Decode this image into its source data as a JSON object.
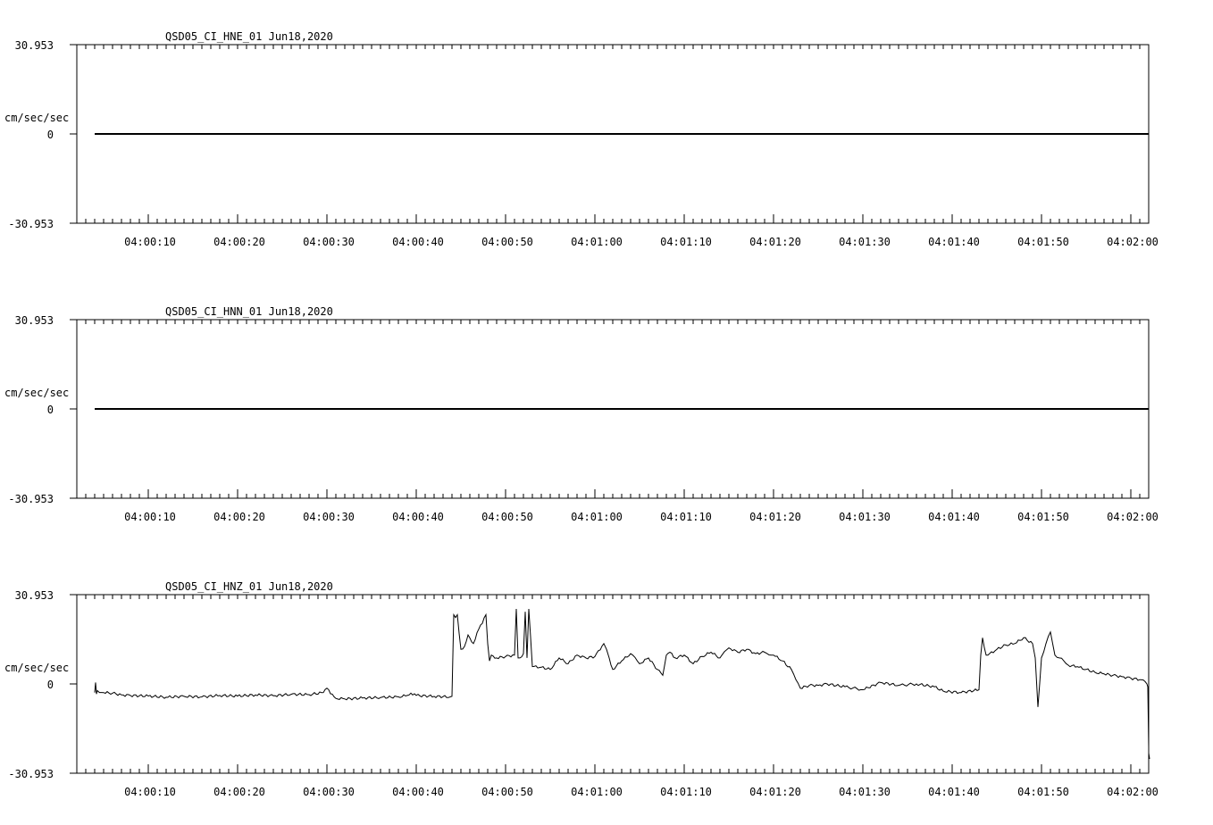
{
  "chart_data": [
    {
      "type": "line",
      "title": "QSD05_CI_HNE_01  Jun18,2020",
      "ylabel": "cm/sec/sec",
      "ylim": [
        -30.953,
        30.953
      ],
      "y_ticks": [
        "30.953",
        "0",
        "-30.953"
      ],
      "x_ticks": [
        "04:00:10",
        "04:00:20",
        "04:00:30",
        "04:00:40",
        "04:00:50",
        "04:01:00",
        "04:01:10",
        "04:01:20",
        "04:01:30",
        "04:01:40",
        "04:01:50",
        "04:02:00"
      ],
      "x_tick_seconds": [
        10,
        20,
        30,
        40,
        50,
        60,
        70,
        80,
        90,
        100,
        110,
        120
      ],
      "xlim_seconds": [
        2,
        122
      ],
      "series": [
        {
          "x": [
            4,
            122
          ],
          "values": [
            0,
            0
          ]
        }
      ]
    },
    {
      "type": "line",
      "title": "QSD05_CI_HNN_01  Jun18,2020",
      "ylabel": "cm/sec/sec",
      "ylim": [
        -30.953,
        30.953
      ],
      "y_ticks": [
        "30.953",
        "0",
        "-30.953"
      ],
      "x_ticks": [
        "04:00:10",
        "04:00:20",
        "04:00:30",
        "04:00:40",
        "04:00:50",
        "04:01:00",
        "04:01:10",
        "04:01:20",
        "04:01:30",
        "04:01:40",
        "04:01:50",
        "04:02:00"
      ],
      "x_tick_seconds": [
        10,
        20,
        30,
        40,
        50,
        60,
        70,
        80,
        90,
        100,
        110,
        120
      ],
      "xlim_seconds": [
        2,
        122
      ],
      "series": [
        {
          "x": [
            4,
            122
          ],
          "values": [
            0,
            0
          ]
        }
      ]
    },
    {
      "type": "line",
      "title": "QSD05_CI_HNZ_01  Jun18,2020",
      "ylabel": "cm/sec/sec",
      "ylim": [
        -30.953,
        30.953
      ],
      "y_ticks": [
        "30.953",
        "0",
        "-30.953"
      ],
      "x_ticks": [
        "04:00:10",
        "04:00:20",
        "04:00:30",
        "04:00:40",
        "04:00:50",
        "04:01:00",
        "04:01:10",
        "04:01:20",
        "04:01:30",
        "04:01:40",
        "04:01:50",
        "04:02:00"
      ],
      "x_tick_seconds": [
        10,
        20,
        30,
        40,
        50,
        60,
        70,
        80,
        90,
        100,
        110,
        120
      ],
      "xlim_seconds": [
        2,
        122
      ],
      "series": [
        {
          "x": [
            4.0,
            4.1,
            4.2,
            4.3,
            5,
            6,
            7,
            8,
            10,
            12,
            14,
            16,
            18,
            20,
            22,
            24,
            26,
            28,
            29.6,
            30,
            30.4,
            31,
            32,
            34,
            36,
            38,
            39,
            39.4,
            40,
            42,
            43.8,
            44.0,
            44.2,
            44.4,
            44.6,
            45.0,
            45.4,
            45.8,
            46.4,
            47.0,
            47.4,
            47.8,
            48.0,
            48.2,
            48.4,
            49,
            50,
            51,
            51.2,
            51.4,
            51.6,
            52,
            52.2,
            52.4,
            52.6,
            53,
            54,
            55,
            56,
            57,
            58,
            59,
            60,
            61,
            61.3,
            61.6,
            62,
            63,
            64,
            65,
            66,
            67,
            67.6,
            68,
            68.4,
            69,
            70,
            71,
            72,
            73,
            74,
            75,
            76,
            77,
            78,
            79,
            80,
            81,
            82,
            82.5,
            83,
            84,
            85,
            86,
            88,
            90,
            92,
            94,
            96,
            98,
            99,
            101,
            103,
            103.2,
            103.4,
            103.8,
            104,
            105,
            106,
            107,
            108,
            109,
            109.3,
            109.6,
            110,
            110.5,
            111,
            111.5,
            112,
            112.5,
            113,
            114,
            115,
            116,
            117,
            118,
            119,
            120,
            121,
            121.6,
            121.8,
            121.9,
            122.0,
            122.0,
            122.1
          ],
          "values": [
            -3.0,
            0.5,
            -3.5,
            -2.3,
            -3.0,
            -3.2,
            -3.8,
            -4.0,
            -4.2,
            -4.6,
            -4.3,
            -4.5,
            -4.0,
            -4.2,
            -3.8,
            -4.1,
            -3.6,
            -3.7,
            -3.0,
            -1.5,
            -3.4,
            -5.0,
            -5.2,
            -4.9,
            -4.7,
            -4.5,
            -4.0,
            -3.2,
            -4.0,
            -4.3,
            -4.5,
            -4.3,
            24.0,
            23.0,
            24.0,
            12.0,
            13.0,
            17.0,
            14.0,
            19.0,
            21.0,
            24.0,
            14.0,
            8.0,
            10.0,
            9.0,
            9.5,
            10.0,
            26.0,
            9.0,
            9.0,
            10.5,
            25.0,
            9.0,
            26.0,
            6.0,
            5.8,
            5.0,
            9.0,
            7.0,
            10.0,
            9.0,
            9.5,
            14.0,
            12.0,
            9.0,
            5.0,
            8.0,
            10.5,
            7.0,
            9.0,
            5.0,
            3.0,
            10.0,
            11.0,
            9.0,
            10.0,
            7.0,
            9.5,
            11.0,
            9.0,
            12.5,
            11.0,
            12.0,
            10.5,
            11.0,
            10.0,
            8.0,
            5.0,
            1.5,
            -1.5,
            -0.5,
            -0.5,
            0.0,
            -1.0,
            -2.0,
            0.5,
            -0.5,
            0.0,
            -1.0,
            -2.5,
            -3.0,
            -2.0,
            10.0,
            16.0,
            10.0,
            10.0,
            12.0,
            13.5,
            14.0,
            16.0,
            14.0,
            9.0,
            -8.0,
            9.0,
            14.0,
            18.0,
            10.0,
            9.0,
            8.0,
            6.5,
            6.0,
            5.0,
            4.0,
            3.5,
            3.0,
            2.5,
            2.0,
            1.5,
            0.8,
            0.0,
            -1.0,
            -22.0,
            -24.0,
            -26.0
          ]
        }
      ]
    }
  ]
}
